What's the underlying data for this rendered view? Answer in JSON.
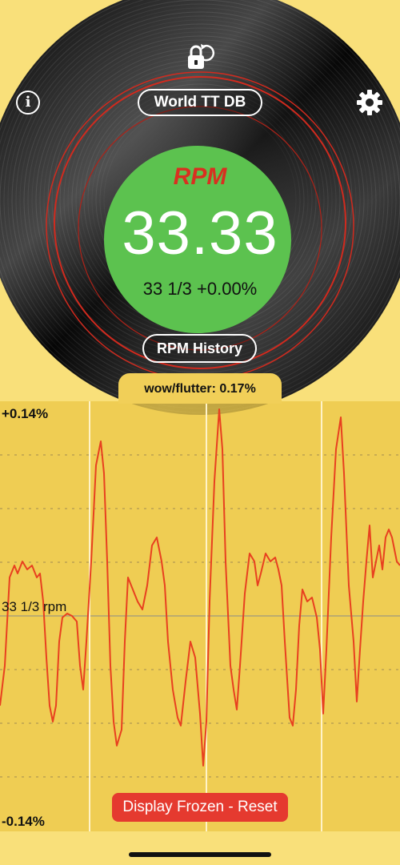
{
  "header": {
    "title_button": "World TT DB",
    "info_icon": "info-icon",
    "settings_icon": "gear-icon",
    "lock_icon": "lock-rotate-icon"
  },
  "readout": {
    "label": "RPM",
    "value": "33.33",
    "speed_offset": "33 1/3 +0.00%"
  },
  "history_button": "RPM History",
  "wow_flutter": {
    "label": "wow/flutter:",
    "value": "0.17%"
  },
  "graph": {
    "top_label": "+0.14%",
    "mid_label": "33 1/3 rpm",
    "bottom_label": "-0.14%",
    "line_color": "#e8401f"
  },
  "reset_button": "Display Frozen - Reset",
  "colors": {
    "background": "#f9e07a",
    "readout_circle": "#5cc24f",
    "rpm_label": "#d93020",
    "reset": "#e53a2f"
  }
}
